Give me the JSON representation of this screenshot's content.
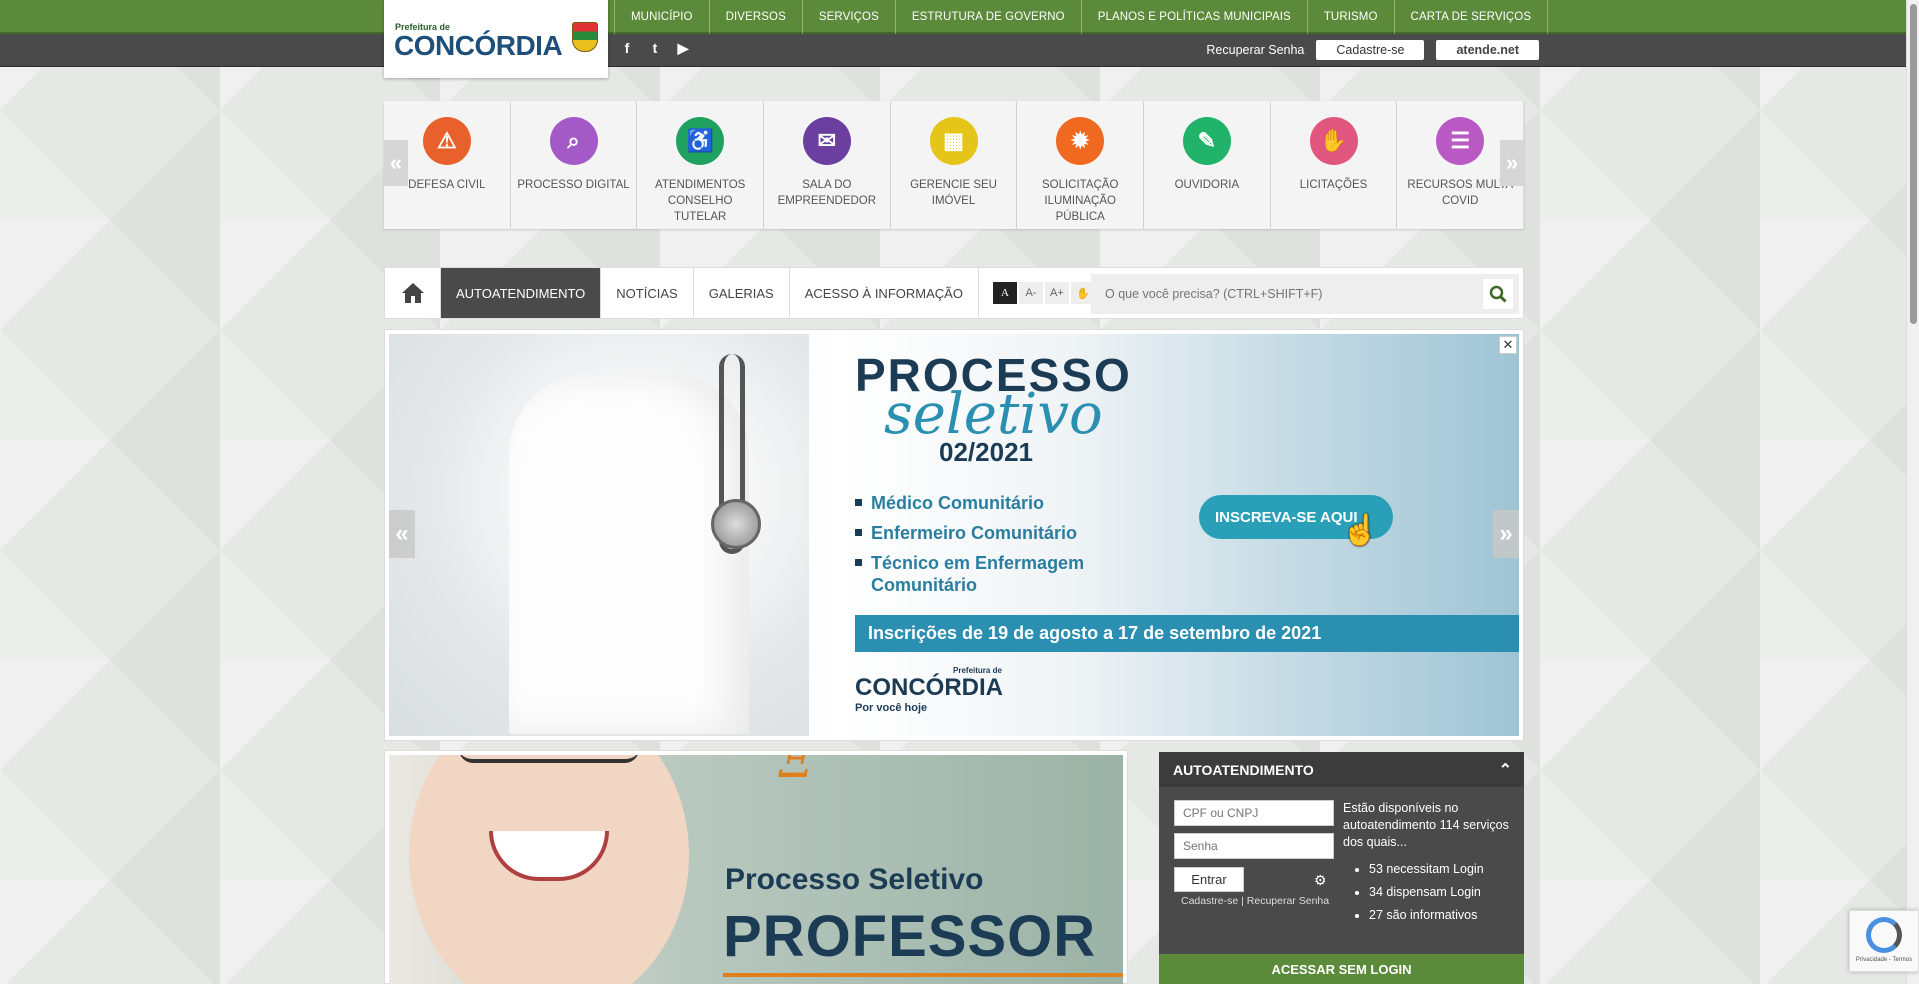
{
  "header": {
    "logo_small": "Prefeitura de",
    "logo_big": "CONCÓRDIA",
    "nav": [
      "MUNICÍPIO",
      "DIVERSOS",
      "SERVIÇOS",
      "ESTRUTURA DE GOVERNO",
      "PLANOS E POLÍTICAS MUNICIPAIS",
      "TURISMO",
      "CARTA DE SERVIÇOS"
    ],
    "social": [
      "facebook-icon",
      "twitter-icon",
      "youtube-icon"
    ],
    "recover_password": "Recuperar Senha",
    "signup": "Cadastre-se",
    "atende": "atende.net"
  },
  "shortcuts": {
    "items": [
      {
        "label": "DEFESA CIVIL",
        "color": "#e8612c",
        "icon": "civil-defense-icon",
        "glyph": "⚠"
      },
      {
        "label": "PROCESSO DIGITAL",
        "color": "#a35ac7",
        "icon": "magnifier-icon",
        "glyph": "⌕"
      },
      {
        "label": "ATENDIMENTOS CONSELHO TUTELAR",
        "color": "#1fa15f",
        "icon": "accessibility-icon",
        "glyph": "♿"
      },
      {
        "label": "SALA DO EMPREENDEDOR",
        "color": "#6b3fa0",
        "icon": "chat-icon",
        "glyph": "✉"
      },
      {
        "label": "GERENCIE SEU IMÓVEL",
        "color": "#e5c51a",
        "icon": "building-icon",
        "glyph": "▦"
      },
      {
        "label": "SOLICITAÇÃO ILUMINAÇÃO PÚBLICA",
        "color": "#ef6a20",
        "icon": "lightbulb-icon",
        "glyph": "✹"
      },
      {
        "label": "OUVIDORIA",
        "color": "#22b36a",
        "icon": "speech-bubble-icon",
        "glyph": "✎"
      },
      {
        "label": "LICITAÇÕES",
        "color": "#e0567f",
        "icon": "handshake-icon",
        "glyph": "✋"
      },
      {
        "label": "RECURSOS MULTA COVID",
        "color": "#b95ac4",
        "icon": "document-icon",
        "glyph": "☰"
      }
    ],
    "prev": "«",
    "next": "»"
  },
  "mainnav": {
    "tabs": [
      "AUTOATENDIMENTO",
      "NOTÍCIAS",
      "GALERIAS",
      "ACESSO À INFORMAÇÃO"
    ],
    "active": "AUTOATENDIMENTO",
    "font_controls": [
      "A",
      "A-",
      "A+",
      "✋"
    ],
    "search_placeholder": "O que você precisa? (CTRL+SHIFT+F)"
  },
  "banner": {
    "title1": "PROCESSO",
    "title2": "seletivo",
    "title3": "02/2021",
    "items": [
      "Médico Comunitário",
      "Enfermeiro Comunitário",
      "Técnico em Enfermagem Comunitário"
    ],
    "cta": "INSCREVA-SE AQUI",
    "dates": "Inscrições de 19 de agosto a 17 de setembro de 2021",
    "logo_pre": "Prefeitura de",
    "logo_big": "CONCÓRDIA",
    "logo_sub": "Por você hoje",
    "close": "✕",
    "prev": "«",
    "next": "»"
  },
  "news_banner": {
    "t1": "Processo Seletivo",
    "t2": "PROFESSOR"
  },
  "autoatendimento": {
    "title": "AUTOATENDIMENTO",
    "cpf_placeholder": "CPF ou CNPJ",
    "password_placeholder": "Senha",
    "enter": "Entrar",
    "signup": "Cadastre-se",
    "separator": "|",
    "recover": "Recuperar Senha",
    "info": "Estão disponíveis no autoatendimento 114 serviços dos quais...",
    "stats": [
      "53 necessitam Login",
      "34 dispensam Login",
      "27 são informativos"
    ],
    "access_without_login": "ACESSAR SEM LOGIN"
  },
  "recaptcha": {
    "text": "Privacidade - Termos"
  }
}
